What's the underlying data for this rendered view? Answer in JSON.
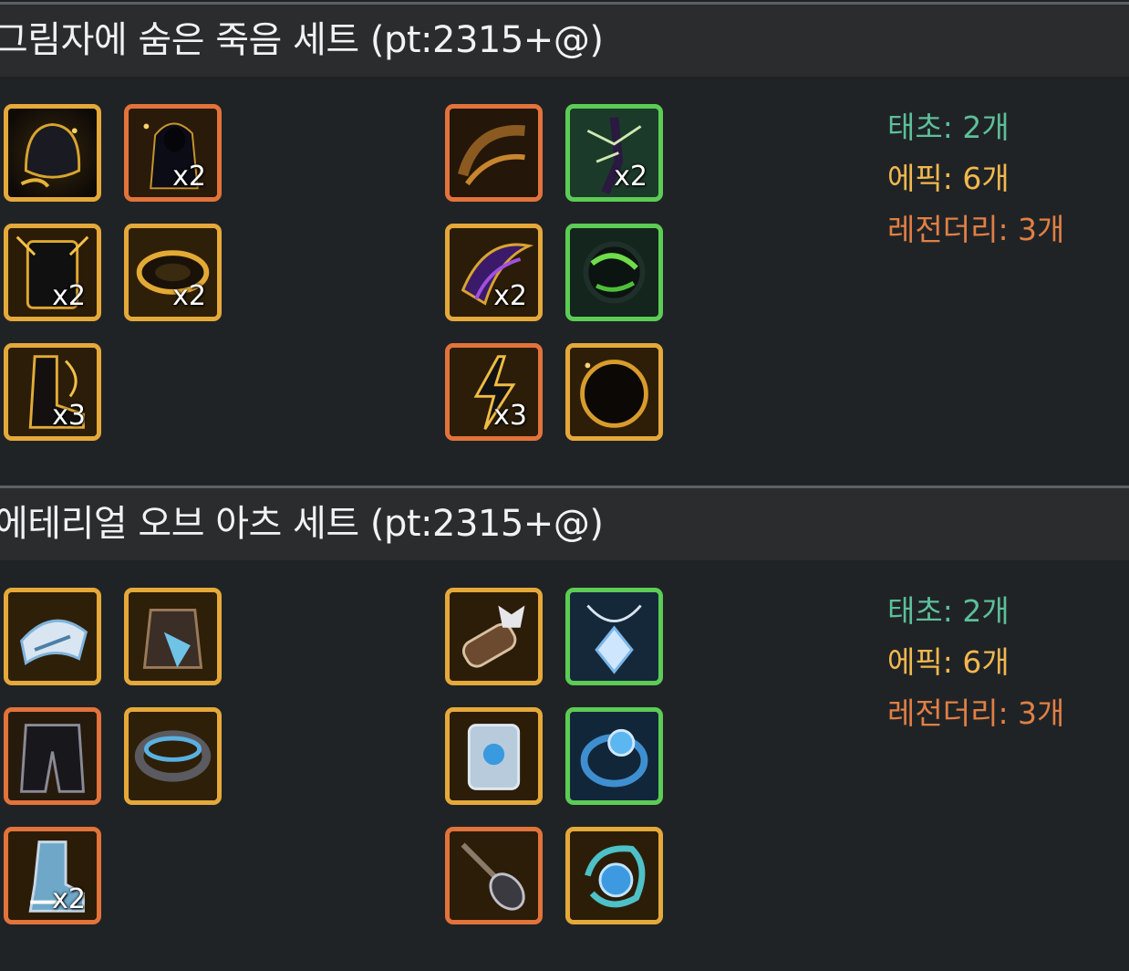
{
  "sets": [
    {
      "title": "그림자에 숨은 죽음 세트 (pt:2315+@)",
      "items": [
        {
          "name": "hood-helmet-icon",
          "rarity": "gold",
          "qty": ""
        },
        {
          "name": "dark-cloak-icon",
          "rarity": "orange",
          "qty": "x2"
        },
        {
          "name": "dark-armor-icon",
          "rarity": "gold",
          "qty": "x2"
        },
        {
          "name": "gold-belt-icon",
          "rarity": "gold",
          "qty": "x2"
        },
        {
          "name": "dark-boots-icon",
          "rarity": "gold",
          "qty": "x3"
        },
        {
          "name": "shadow-bracelet-icon",
          "rarity": "orange",
          "qty": ""
        },
        {
          "name": "thorn-necklace-icon",
          "rarity": "green",
          "qty": "x2"
        },
        {
          "name": "purple-crescent-icon",
          "rarity": "gold",
          "qty": "x2"
        },
        {
          "name": "green-orb-icon",
          "rarity": "green",
          "qty": ""
        },
        {
          "name": "lightning-stone-icon",
          "rarity": "orange",
          "qty": "x3"
        },
        {
          "name": "dark-ring-icon",
          "rarity": "gold",
          "qty": ""
        }
      ],
      "summary": {
        "taecho": "태초: 2개",
        "epic": "에픽: 6개",
        "legendary": "레전더리: 3개"
      }
    },
    {
      "title": "에테리얼 오브 아츠 세트 (pt:2315+@)",
      "items": [
        {
          "name": "ethereal-shoulder-icon",
          "rarity": "gold",
          "qty": ""
        },
        {
          "name": "ethereal-coat-icon",
          "rarity": "gold",
          "qty": ""
        },
        {
          "name": "ethereal-pants-icon",
          "rarity": "orange",
          "qty": ""
        },
        {
          "name": "ethereal-belt-icon",
          "rarity": "gold",
          "qty": ""
        },
        {
          "name": "ethereal-boots-icon",
          "rarity": "orange",
          "qty": "x2"
        },
        {
          "name": "wolf-bracer-icon",
          "rarity": "gold",
          "qty": ""
        },
        {
          "name": "crystal-necklace-icon",
          "rarity": "green",
          "qty": ""
        },
        {
          "name": "silver-shield-icon",
          "rarity": "gold",
          "qty": ""
        },
        {
          "name": "blue-ring-icon",
          "rarity": "green",
          "qty": ""
        },
        {
          "name": "spiked-mace-icon",
          "rarity": "orange",
          "qty": ""
        },
        {
          "name": "water-orb-icon",
          "rarity": "gold",
          "qty": ""
        }
      ],
      "summary": {
        "taecho": "태초: 2개",
        "epic": "에픽: 6개",
        "legendary": "레전더리: 3개"
      }
    }
  ],
  "colors": {
    "gold": "#e5a93a",
    "orange": "#e2733a",
    "green": "#5ccc55",
    "blue": "#4aa2de",
    "taecho": "#5dbf99",
    "epic": "#f2b84e",
    "legendary": "#e08044"
  }
}
